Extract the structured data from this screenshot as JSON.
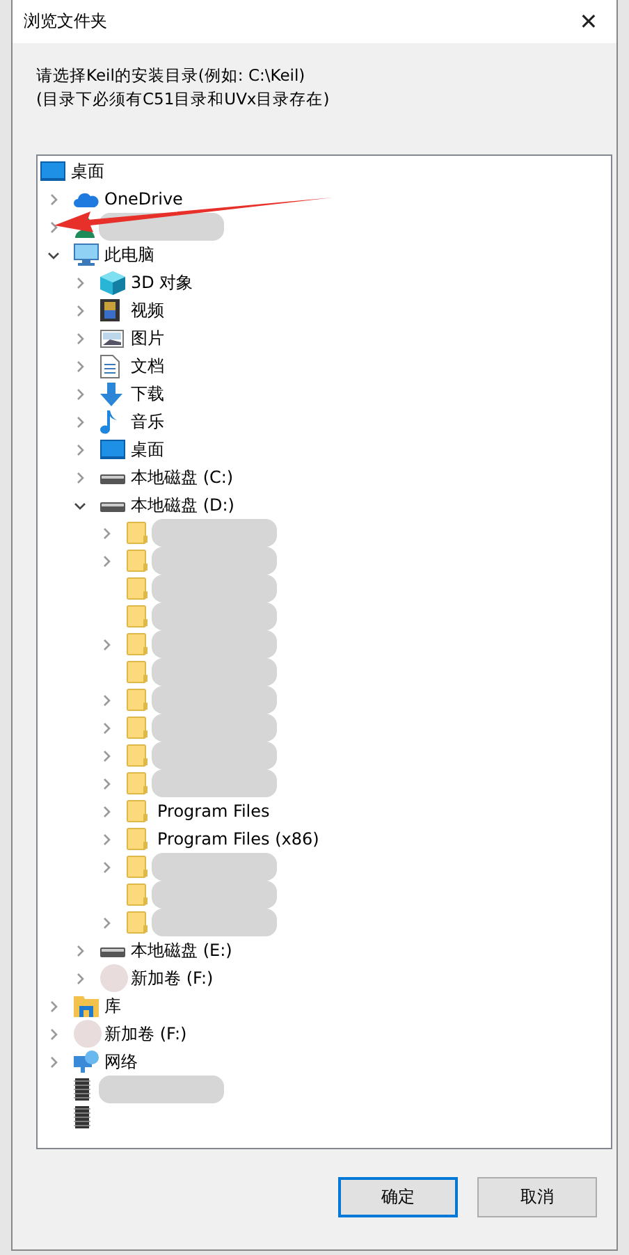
{
  "window": {
    "title": "浏览文件夹",
    "close": "✕"
  },
  "instructions": [
    "请选择Keil的安装目录(例如: C:\\Keil)",
    "(目录下必须有C51目录和UVx目录存在)"
  ],
  "tree": [
    {
      "label": "桌面",
      "kind": "desktop",
      "children": [
        {
          "label": "OneDrive",
          "kind": "cloud",
          "expanded": false
        },
        {
          "kind": "user",
          "redacted": true,
          "expanded": false
        },
        {
          "label": "此电脑",
          "kind": "pc",
          "expanded": true,
          "children": [
            {
              "label": "3D 对象",
              "kind": "cube",
              "expanded": false
            },
            {
              "label": "视频",
              "kind": "video",
              "expanded": false
            },
            {
              "label": "图片",
              "kind": "image",
              "expanded": false
            },
            {
              "label": "文档",
              "kind": "document",
              "expanded": false
            },
            {
              "label": "下载",
              "kind": "download",
              "expanded": false
            },
            {
              "label": "音乐",
              "kind": "music",
              "expanded": false
            },
            {
              "label": "桌面",
              "kind": "desktop",
              "expanded": false
            },
            {
              "label": "本地磁盘 (C:)",
              "kind": "drive",
              "expanded": false
            },
            {
              "label": "本地磁盘 (D:)",
              "kind": "drive",
              "expanded": true,
              "children": [
                {
                  "kind": "folder",
                  "redacted": true,
                  "expanded": false
                },
                {
                  "kind": "folder",
                  "redacted": true,
                  "expanded": false
                },
                {
                  "kind": "folder",
                  "redacted": true
                },
                {
                  "kind": "folder",
                  "redacted": true
                },
                {
                  "kind": "folder",
                  "redacted": true,
                  "expanded": false
                },
                {
                  "kind": "folder",
                  "redacted": true
                },
                {
                  "kind": "folder",
                  "redacted": true,
                  "expanded": false
                },
                {
                  "kind": "folder",
                  "redacted": true,
                  "expanded": false
                },
                {
                  "kind": "folder",
                  "redacted": true,
                  "expanded": false
                },
                {
                  "kind": "folder",
                  "redacted": true,
                  "expanded": false
                },
                {
                  "label": "Program Files",
                  "kind": "folder",
                  "expanded": false
                },
                {
                  "label": "Program Files (x86)",
                  "kind": "folder",
                  "expanded": false
                },
                {
                  "kind": "folder",
                  "redacted": true,
                  "expanded": false
                },
                {
                  "kind": "folder",
                  "redacted": true
                },
                {
                  "kind": "folder",
                  "redacted": true,
                  "expanded": false
                }
              ]
            },
            {
              "label": "本地磁盘 (E:)",
              "kind": "drive",
              "expanded": false
            },
            {
              "label": "新加卷 (F:)",
              "kind": "disc",
              "expanded": false
            }
          ]
        },
        {
          "label": "库",
          "kind": "library",
          "expanded": false
        },
        {
          "label": "新加卷 (F:)",
          "kind": "disc",
          "expanded": false
        },
        {
          "label": "网络",
          "kind": "network",
          "expanded": false
        },
        {
          "kind": "chip",
          "redacted": true
        },
        {
          "kind": "chip"
        }
      ]
    }
  ],
  "buttons": [
    {
      "label": "确定",
      "default": true
    },
    {
      "label": "取消",
      "default": false
    }
  ]
}
